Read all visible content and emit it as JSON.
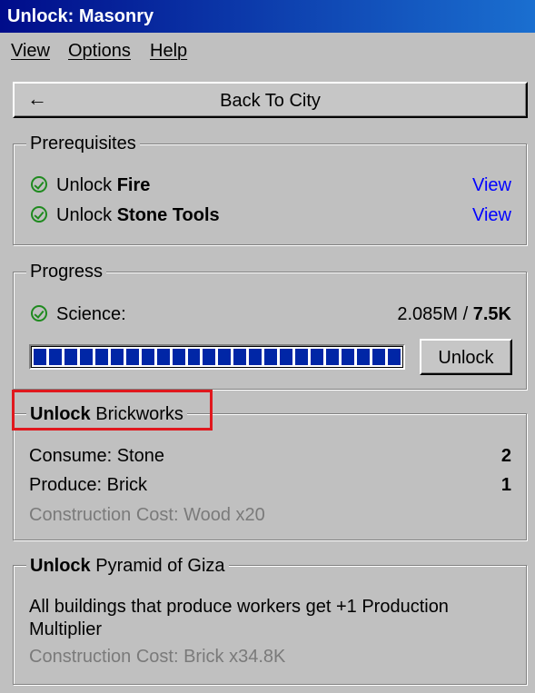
{
  "window": {
    "title": "Unlock: Masonry"
  },
  "menu": [
    {
      "label": "View"
    },
    {
      "label": "Options"
    },
    {
      "label": "Help"
    }
  ],
  "back_button": {
    "icon": "arrow-left-icon",
    "label": "Back To City"
  },
  "prerequisites": {
    "title": "Prerequisites",
    "items": [
      {
        "prefix": "Unlock",
        "name": "Fire",
        "link": "View"
      },
      {
        "prefix": "Unlock",
        "name": "Stone Tools",
        "link": "View"
      }
    ]
  },
  "progress": {
    "title": "Progress",
    "label": "Science:",
    "current": "2.085M",
    "separator": " / ",
    "required": "7.5K",
    "fraction": 1.0,
    "button": "Unlock"
  },
  "brickworks": {
    "title_bold": "Unlock",
    "title_rest": " Brickworks",
    "consume_label": "Consume: Stone",
    "consume_value": "2",
    "produce_label": "Produce: Brick",
    "produce_value": "1",
    "cost": "Construction Cost: Wood x20"
  },
  "pyramid": {
    "title_bold": "Unlock",
    "title_rest": " Pyramid of Giza",
    "description_line1": "All buildings that produce workers get +1 Production",
    "description_line2": "Multiplier",
    "cost": "Construction Cost: Brick x34.8K"
  },
  "colors": {
    "title_start": "#000c8a",
    "title_end": "#1a6fd0",
    "progress": "#0026a6",
    "highlight": "#e0181e",
    "link": "#0000ff",
    "check": "#1f8a1f"
  }
}
